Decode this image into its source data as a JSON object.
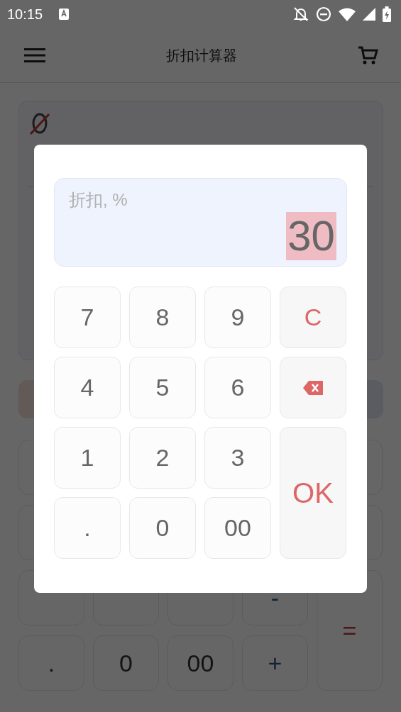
{
  "status_bar": {
    "time": "10:15"
  },
  "app_bar": {
    "title": "折扣计算器"
  },
  "actions": [
    {
      "kind": "discount"
    },
    {
      "kind": "tax"
    }
  ],
  "keypad": [
    {
      "kind": "hidden"
    },
    {
      "kind": "hidden"
    },
    {
      "kind": "hidden"
    },
    {
      "kind": "hidden"
    },
    {
      "kind": "hidden"
    },
    {
      "kind": "hidden"
    },
    {
      "kind": "hidden"
    },
    {
      "kind": "operator",
      "label": "-"
    },
    {
      "kind": "equals",
      "label": "="
    },
    {
      "kind": "digit",
      "label": "."
    },
    {
      "kind": "digit",
      "label": "0"
    },
    {
      "kind": "digit",
      "label": "00"
    },
    {
      "kind": "operator",
      "label": "+"
    }
  ],
  "dialog": {
    "field": {
      "label": "折扣, %",
      "value": "30",
      "value_selected": true
    },
    "keys": [
      {
        "kind": "digit",
        "label": "7"
      },
      {
        "kind": "digit",
        "label": "8"
      },
      {
        "kind": "digit",
        "label": "9"
      },
      {
        "kind": "clear",
        "label": "C"
      },
      {
        "kind": "digit",
        "label": "4"
      },
      {
        "kind": "digit",
        "label": "5"
      },
      {
        "kind": "digit",
        "label": "6"
      },
      {
        "kind": "backspace"
      },
      {
        "kind": "digit",
        "label": "1"
      },
      {
        "kind": "digit",
        "label": "2"
      },
      {
        "kind": "digit",
        "label": "3"
      },
      {
        "kind": "ok",
        "label": "OK"
      },
      {
        "kind": "digit",
        "label": "."
      },
      {
        "kind": "digit",
        "label": "0"
      },
      {
        "kind": "digit",
        "label": "00"
      }
    ]
  }
}
